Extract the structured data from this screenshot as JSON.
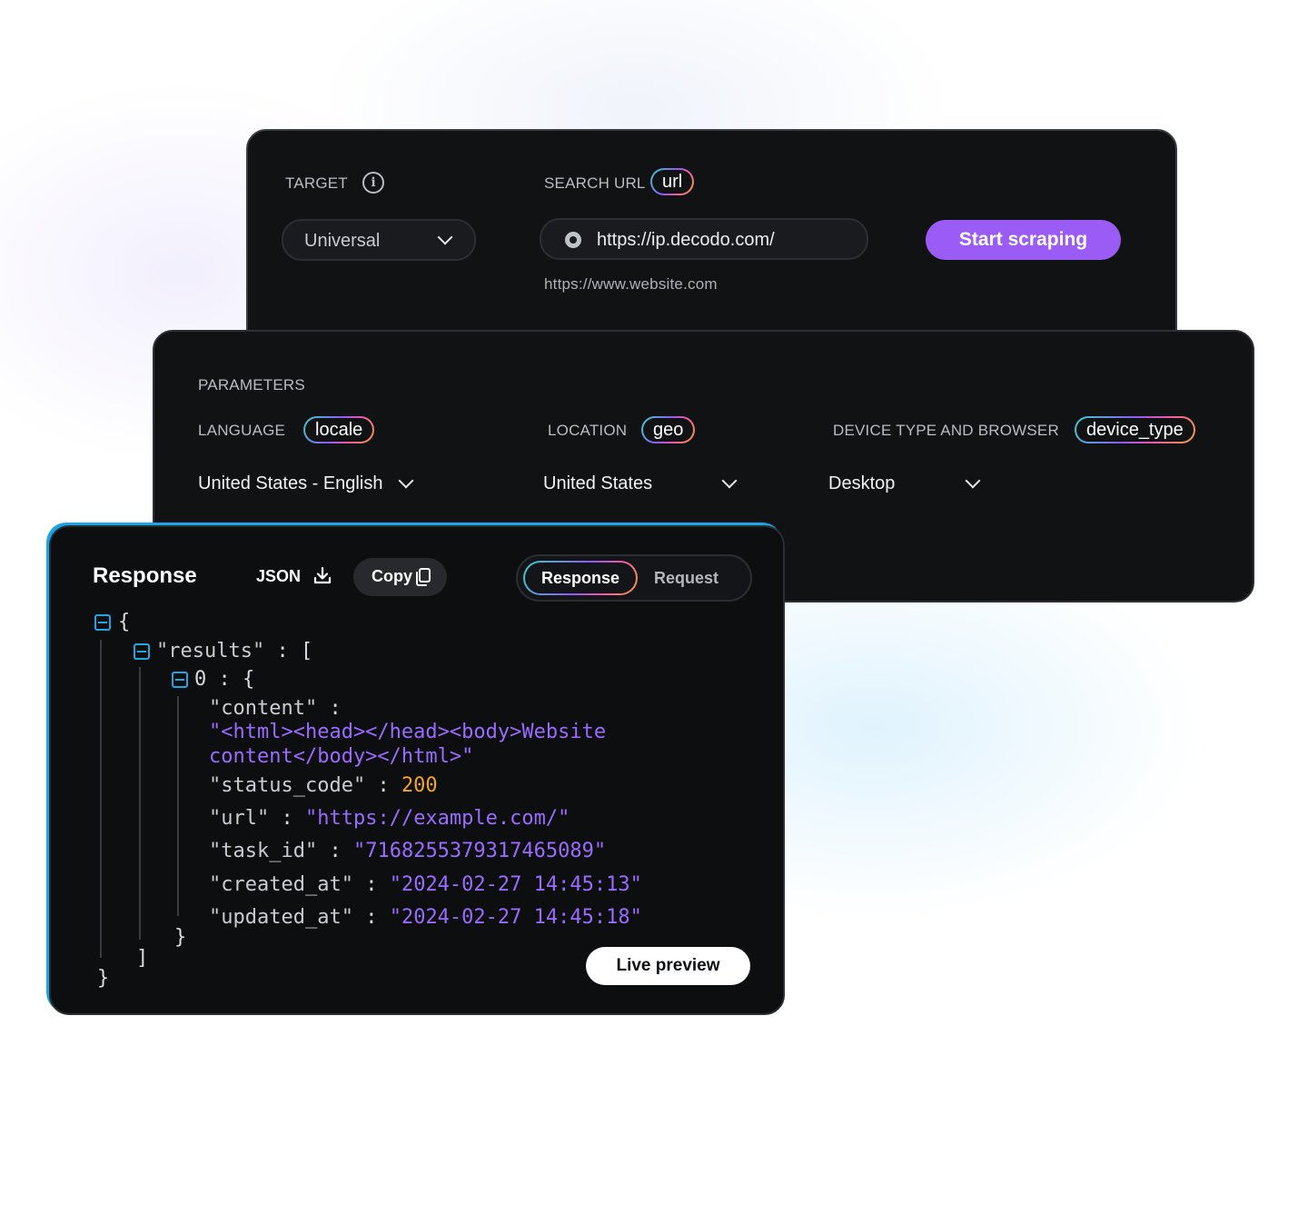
{
  "target_panel": {
    "target_label": "TARGET",
    "search_url_label": "SEARCH URL",
    "url_tag": "url",
    "target_select_value": "Universal",
    "url_input_value": "https://ip.decodo.com/",
    "url_hint": "https://www.website.com",
    "start_button": "Start scraping"
  },
  "params_panel": {
    "title": "PARAMETERS",
    "language_label": "LANGUAGE",
    "language_tag": "locale",
    "language_value": "United States - English",
    "location_label": "LOCATION",
    "location_tag": "geo",
    "location_value": "United States",
    "device_label": "DEVICE TYPE AND BROWSER",
    "device_tag": "device_type",
    "device_value": "Desktop"
  },
  "response_panel": {
    "title": "Response",
    "json_button": "JSON",
    "copy_button": "Copy",
    "tabs": [
      {
        "label": "Response",
        "active": true
      },
      {
        "label": "Request",
        "active": false
      }
    ],
    "code": {
      "open_brace": "{",
      "results_key": "\"results\"",
      "colon": ":",
      "open_bracket": "[",
      "index": "0",
      "content_key": "\"content\"",
      "content_value_line1": "\"<html><head></head><body>Website",
      "content_value_line2": "content</body></html>\"",
      "status_code_key": "\"status_code\"",
      "status_code_value": "200",
      "url_key": "\"url\"",
      "url_value": "\"https://example.com/\"",
      "task_id_key": "\"task_id\"",
      "task_id_value": "\"7168255379317465089\"",
      "created_at_key": "\"created_at\"",
      "created_at_value": "\"2024-02-27 14:45:13\"",
      "updated_at_key": "\"updated_at\"",
      "updated_at_value": "\"2024-02-27 14:45:18\"",
      "close_brace_inner": "}",
      "close_bracket": "]",
      "close_brace": "}"
    },
    "live_preview_button": "Live preview"
  },
  "colors": {
    "accent_purple": "#9b5cf6",
    "collapse_blue": "#1fa6e3",
    "string_purple": "#9b6bff",
    "number_orange": "#f5a524"
  }
}
